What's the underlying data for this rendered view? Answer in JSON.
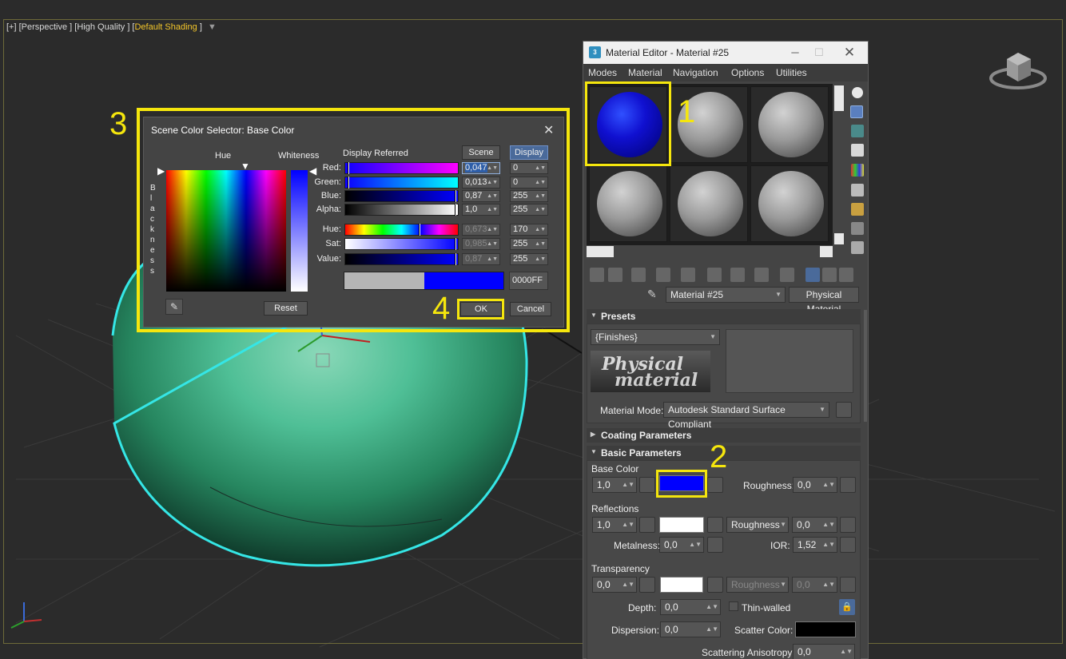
{
  "viewport": {
    "label_prefix": "[+] [Perspective ] [High Quality ] [",
    "shading": "Default Shading",
    "label_suffix": " ]"
  },
  "material_editor": {
    "title": "Material Editor - Material #25",
    "menu": [
      "Modes",
      "Material",
      "Navigation",
      "Options",
      "Utilities"
    ],
    "material_name": "Material #25",
    "material_type": "Physical Material",
    "presets": {
      "header": "Presets",
      "dropdown": "{Finishes}",
      "logo_line1": "Physical",
      "logo_line2": "material"
    },
    "material_mode_label": "Material Mode:",
    "material_mode_value": "Autodesk Standard Surface Compliant",
    "coating_header": "Coating Parameters",
    "basic_header": "Basic Parameters",
    "base_color": {
      "label": "Base Color",
      "weight": "1,0",
      "color": "#0000ff",
      "roughness_label": "Roughness:",
      "roughness": "0,0"
    },
    "reflections": {
      "label": "Reflections",
      "weight": "1,0",
      "color": "#ffffff",
      "roughness_dropdown": "Roughness",
      "roughness": "0,0",
      "metalness_label": "Metalness:",
      "metalness": "0,0",
      "ior_label": "IOR:",
      "ior": "1,52"
    },
    "transparency": {
      "label": "Transparency",
      "weight": "0,0",
      "color": "#ffffff",
      "roughness_dropdown": "Roughness",
      "roughness": "0,0",
      "depth_label": "Depth:",
      "depth": "0,0",
      "thin_walled_label": "Thin-walled",
      "dispersion_label": "Dispersion:",
      "dispersion": "0,0",
      "scatter_color_label": "Scatter Color:",
      "scatter_color": "#000000",
      "scattering_label": "Scattering Anisotropy:",
      "scattering": "0,0"
    }
  },
  "color_selector": {
    "title": "Scene Color Selector: Base Color",
    "hue_label": "Hue",
    "whiteness_label": "Whiteness",
    "blackness_label": "B l a c k n e s s",
    "display_referred": "Display Referred",
    "scene_button": "Scene",
    "display_button": "Display",
    "channels": [
      {
        "label": "Red:",
        "value": "0,047",
        "display": "0",
        "dim": false
      },
      {
        "label": "Green:",
        "value": "0,013",
        "display": "0",
        "dim": false
      },
      {
        "label": "Blue:",
        "value": "0,87",
        "display": "255",
        "dim": false
      },
      {
        "label": "Alpha:",
        "value": "1,0",
        "display": "255",
        "dim": false
      },
      {
        "label": "Hue:",
        "value": "0,673",
        "display": "170",
        "dim": true
      },
      {
        "label": "Sat:",
        "value": "0,985",
        "display": "255",
        "dim": true
      },
      {
        "label": "Value:",
        "value": "0,87",
        "display": "255",
        "dim": true
      }
    ],
    "hex": "0000FF",
    "current_color": "#0000ff",
    "reset_button": "Reset",
    "ok_button": "OK",
    "cancel_button": "Cancel"
  },
  "annotations": {
    "step1": "1",
    "step2": "2",
    "step3": "3",
    "step4": "4"
  }
}
